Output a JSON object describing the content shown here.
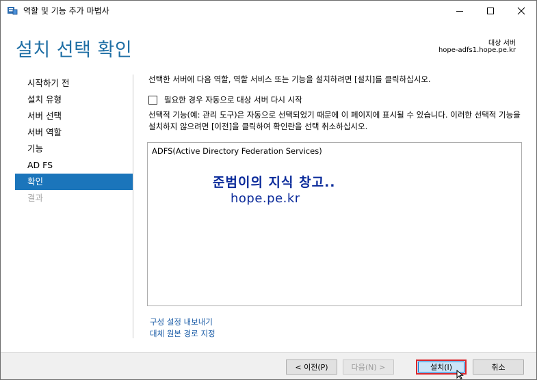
{
  "window": {
    "title": "역할 및 기능 추가 마법사"
  },
  "header": {
    "page_title": "설치 선택 확인",
    "target_label": "대상 서버",
    "target_server": "hope-adfs1.hope.pe.kr"
  },
  "sidebar": {
    "items": [
      {
        "label": "시작하기 전",
        "state": "normal"
      },
      {
        "label": "설치 유형",
        "state": "normal"
      },
      {
        "label": "서버 선택",
        "state": "normal"
      },
      {
        "label": "서버 역할",
        "state": "normal"
      },
      {
        "label": "기능",
        "state": "normal"
      },
      {
        "label": "AD FS",
        "state": "normal"
      },
      {
        "label": "확인",
        "state": "active"
      },
      {
        "label": "결과",
        "state": "disabled"
      }
    ]
  },
  "main": {
    "intro": "선택한 서버에 다음 역할, 역할 서비스 또는 기능을 설치하려면 [설치]를 클릭하십시오.",
    "restart_checkbox_label": "필요한 경우 자동으로 대상 서버 다시 시작",
    "restart_checked": false,
    "optional_note": "선택적 기능(예: 관리 도구)은 자동으로 선택되었기 때문에 이 페이지에 표시될 수 있습니다. 이러한 선택적 기능을 설치하지 않으려면 [이전]을 클릭하여 확인란을 선택 취소하십시오.",
    "features": [
      "ADFS(Active Directory Federation Services)"
    ],
    "watermark": {
      "line1": "준범이의 지식 창고..",
      "line2": "hope.pe.kr"
    },
    "export_link": "구성 설정 내보내기",
    "alt_source_link": "대체 원본 경로 지정"
  },
  "footer": {
    "prev_label": "< 이전(P)",
    "next_label": "다음(N) >",
    "install_label": "설치(I)",
    "cancel_label": "취소"
  },
  "colors": {
    "accent": "#1b75bb",
    "title_blue": "#1f6fa5",
    "highlight_red": "#d9262c"
  },
  "icons": {
    "app": "server-manager-icon",
    "minimize": "minimize-icon",
    "maximize": "maximize-icon",
    "close": "close-icon",
    "cursor": "mouse-cursor-icon"
  }
}
